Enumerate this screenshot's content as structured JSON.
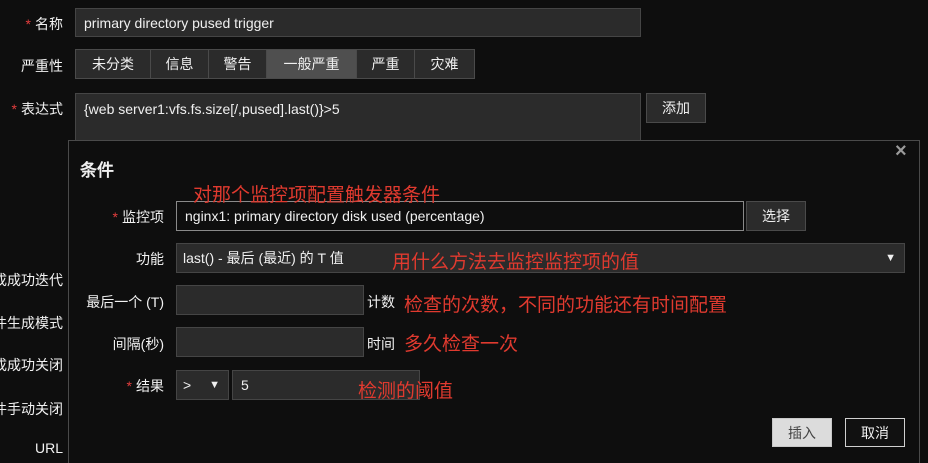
{
  "form": {
    "name_label": "名称",
    "name_value": "primary directory pused trigger",
    "severity_label": "严重性",
    "severity_options": [
      "未分类",
      "信息",
      "警告",
      "一般严重",
      "严重",
      "灾难"
    ],
    "severity_selected": "一般严重",
    "expression_label": "表达式",
    "expression_value": "{web server1:vfs.fs.size[/,pused].last()}>5",
    "add_button": "添加",
    "side_labels": [
      "式生成成功迭代",
      "事件生成模式",
      "式生成成功关闭",
      "事件手动关闭",
      "URL"
    ]
  },
  "modal": {
    "title": "条件",
    "close_icon": "×",
    "item_label": "监控项",
    "item_value": "nginx1: primary directory disk used (percentage)",
    "select_button": "选择",
    "function_label": "功能",
    "function_value": "last() - 最后  (最近)  的 T 值",
    "last_label": "最后一个 (T)",
    "last_value": "",
    "count_suffix": "计数",
    "interval_label": "间隔(秒)",
    "interval_value": "",
    "time_suffix": "时间",
    "result_label": "结果",
    "operator_value": ">",
    "result_value": "5",
    "insert_button": "插入",
    "cancel_button": "取消"
  },
  "annotations": {
    "a1": "对那个监控项配置触发器条件",
    "a2": "用什么方法去监控监控项的值",
    "a3": "检查的次数，不同的功能还有时间配置",
    "a4": "多久检查一次",
    "a5": "检测的阈值"
  }
}
